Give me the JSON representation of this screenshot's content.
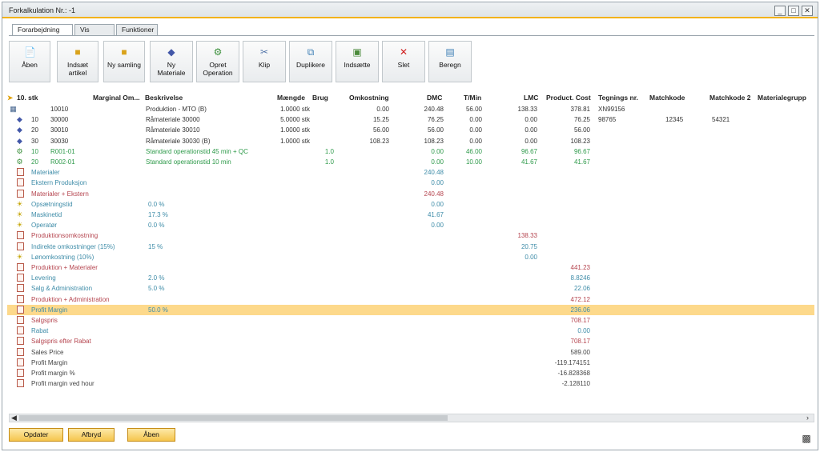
{
  "window": {
    "title": "Forkalkulation Nr.: -1",
    "buttons": [
      "_",
      "□",
      "✕"
    ]
  },
  "tabs": [
    "Forarbejdning",
    "Vis",
    "Funktioner"
  ],
  "ribbon": [
    {
      "label": "Åben",
      "icon": "open-icon"
    },
    {
      "label": "Indsæt\nartikel",
      "icon": "folder-icon"
    },
    {
      "label": "Ny samling",
      "icon": "folder-icon"
    },
    {
      "label": "Ny\nMateriale",
      "icon": "cube-icon"
    },
    {
      "label": "Opret\nOperation",
      "icon": "gear-icon"
    },
    {
      "label": "Klip",
      "icon": "scissors-icon"
    },
    {
      "label": "Duplikere",
      "icon": "duplicate-icon"
    },
    {
      "label": "Indsætte",
      "icon": "paste-icon"
    },
    {
      "label": "Slet",
      "icon": "delete-icon"
    },
    {
      "label": "Beregn",
      "icon": "calculate-icon"
    }
  ],
  "columns": {
    "level": "10. stk",
    "margin": "Marginal Om...",
    "desc": "Beskrivelse",
    "qty": "Mængde",
    "use": "Brug",
    "cost": "Omkostning",
    "dmc": "DMC",
    "tmin": "T/Min",
    "lmc": "LMC",
    "pcost": "Product. Cost",
    "drawing": "Tegnings nr.",
    "match": "Matchkode",
    "match2": "Matchkode 2",
    "matgroup": "Materialegrupp"
  },
  "rows": [
    {
      "icon": "table-icon",
      "pos": "",
      "item": "10010",
      "desc": "Produktion - MTO (B)",
      "qty": "1.0000 stk",
      "use": "",
      "cost": "0.00",
      "dmc": "240.48",
      "tmin": "56.00",
      "lmc": "138.33",
      "pcost": "378.81",
      "drawing": "XN99156",
      "match": "",
      "match2": "",
      "color": "#333333"
    },
    {
      "icon": "cube-icon",
      "pos": "10",
      "item": "30000",
      "desc": "Råmateriale 30000",
      "qty": "5.0000 stk",
      "use": "",
      "cost": "15.25",
      "dmc": "76.25",
      "tmin": "0.00",
      "lmc": "0.00",
      "pcost": "76.25",
      "drawing": "98765",
      "match": "12345",
      "match2": "54321",
      "color": "#333333"
    },
    {
      "icon": "cube-icon",
      "pos": "20",
      "item": "30010",
      "desc": "Råmateriale 30010",
      "qty": "1.0000 stk",
      "use": "",
      "cost": "56.00",
      "dmc": "56.00",
      "tmin": "0.00",
      "lmc": "0.00",
      "pcost": "56.00",
      "drawing": "",
      "match": "",
      "match2": "",
      "color": "#333333"
    },
    {
      "icon": "cube-icon",
      "pos": "30",
      "item": "30030",
      "desc": "Råmateriale 30030 (B)",
      "qty": "1.0000 stk",
      "use": "",
      "cost": "108.23",
      "dmc": "108.23",
      "tmin": "0.00",
      "lmc": "0.00",
      "pcost": "108.23",
      "drawing": "",
      "match": "",
      "match2": "",
      "color": "#333333"
    },
    {
      "icon": "gear-icon",
      "pos": "10",
      "item": "R001-01",
      "desc": "Standard operationstid 45 min + QC",
      "qty": "",
      "use": "1.0",
      "cost": "",
      "dmc": "0.00",
      "tmin": "46.00",
      "lmc": "96.67",
      "pcost": "96.67",
      "drawing": "",
      "match": "",
      "match2": "",
      "color": "#2e9a4a"
    },
    {
      "icon": "gear-icon",
      "pos": "20",
      "item": "R002-01",
      "desc": "Standard operationstid 10 min",
      "qty": "",
      "use": "1.0",
      "cost": "",
      "dmc": "0.00",
      "tmin": "10.00",
      "lmc": "41.67",
      "pcost": "41.67",
      "drawing": "",
      "match": "",
      "match2": "",
      "color": "#2e9a4a"
    },
    {
      "icon": "doc-icon",
      "label": "Materialer",
      "margin": "",
      "dmc": "240.48",
      "lmc": "",
      "pcost": "",
      "color": "#3e8ca8"
    },
    {
      "icon": "doc-icon",
      "label": "Ekstern Produksjon",
      "margin": "",
      "dmc": "0.00",
      "lmc": "",
      "pcost": "",
      "color": "#3e8ca8"
    },
    {
      "icon": "doc-icon",
      "label": "Materialer + Ekstern",
      "margin": "",
      "dmc": "240.48",
      "lmc": "",
      "pcost": "",
      "color": "#b5454f"
    },
    {
      "icon": "bulb-icon",
      "label": "Opsætningstid",
      "margin": "0.0 %",
      "dmc": "0.00",
      "lmc": "",
      "pcost": "",
      "color": "#3e8ca8"
    },
    {
      "icon": "bulb-icon",
      "label": "Maskinetid",
      "margin": "17.3 %",
      "dmc": "41.67",
      "lmc": "",
      "pcost": "",
      "color": "#3e8ca8"
    },
    {
      "icon": "bulb-icon",
      "label": "Operatør",
      "margin": "0.0 %",
      "dmc": "0.00",
      "lmc": "",
      "pcost": "",
      "color": "#3e8ca8"
    },
    {
      "icon": "doc-icon",
      "label": "Produktionsomkostning",
      "margin": "",
      "dmc": "",
      "lmc": "138.33",
      "pcost": "",
      "color": "#b5454f"
    },
    {
      "icon": "doc-icon",
      "label": "Indirekte omkostninger (15%)",
      "margin": "15 %",
      "dmc": "",
      "lmc": "20.75",
      "pcost": "",
      "color": "#3e8ca8"
    },
    {
      "icon": "bulb-icon",
      "label": "Lønomkostning (10%)",
      "margin": "",
      "dmc": "",
      "lmc": "0.00",
      "pcost": "",
      "color": "#3e8ca8"
    },
    {
      "icon": "doc-icon",
      "label": "Produktion + Materialer",
      "margin": "",
      "dmc": "",
      "lmc": "",
      "pcost": "441.23",
      "color": "#b5454f"
    },
    {
      "icon": "doc-icon",
      "label": "Levering",
      "margin": "2.0 %",
      "dmc": "",
      "lmc": "",
      "pcost": "8.8246",
      "color": "#3e8ca8"
    },
    {
      "icon": "doc-icon",
      "label": "Salg & Administration",
      "margin": "5.0 %",
      "dmc": "",
      "lmc": "",
      "pcost": "22.06",
      "color": "#3e8ca8"
    },
    {
      "icon": "doc-icon",
      "label": "Produktion + Administration",
      "margin": "",
      "dmc": "",
      "lmc": "",
      "pcost": "472.12",
      "color": "#b5454f"
    },
    {
      "icon": "doc-icon",
      "label": "Profit Margin",
      "margin": "50.0 %",
      "dmc": "",
      "lmc": "",
      "pcost": "236.06",
      "color": "#3e8ca8",
      "highlight": true
    },
    {
      "icon": "doc-icon",
      "label": "Salgspris",
      "margin": "",
      "dmc": "",
      "lmc": "",
      "pcost": "708.17",
      "color": "#b5454f"
    },
    {
      "icon": "doc-icon",
      "label": "Rabat",
      "margin": "",
      "dmc": "",
      "lmc": "",
      "pcost": "0.00",
      "color": "#3e8ca8"
    },
    {
      "icon": "doc-icon",
      "label": "Salgspris efter Rabat",
      "margin": "",
      "dmc": "",
      "lmc": "",
      "pcost": "708.17",
      "color": "#b5454f"
    },
    {
      "icon": "doc-icon",
      "label": "Sales Price",
      "margin": "",
      "dmc": "",
      "lmc": "",
      "pcost": "589.00",
      "color": "#444444"
    },
    {
      "icon": "doc-icon",
      "label": "Profit Margin",
      "margin": "",
      "dmc": "",
      "lmc": "",
      "pcost": "-119.174151",
      "color": "#444444"
    },
    {
      "icon": "doc-icon",
      "label": "Profit margin %",
      "margin": "",
      "dmc": "",
      "lmc": "",
      "pcost": "-16.828368",
      "color": "#444444"
    },
    {
      "icon": "doc-icon",
      "label": "Profit margin ved hour",
      "margin": "",
      "dmc": "",
      "lmc": "",
      "pcost": "-2.128110",
      "color": "#444444"
    }
  ],
  "bottom_buttons": {
    "update": "Opdater",
    "cancel": "Afbryd",
    "open": "Åben"
  },
  "colors": {
    "accent": "#f2b21a",
    "highlight": "#fdd98b"
  }
}
